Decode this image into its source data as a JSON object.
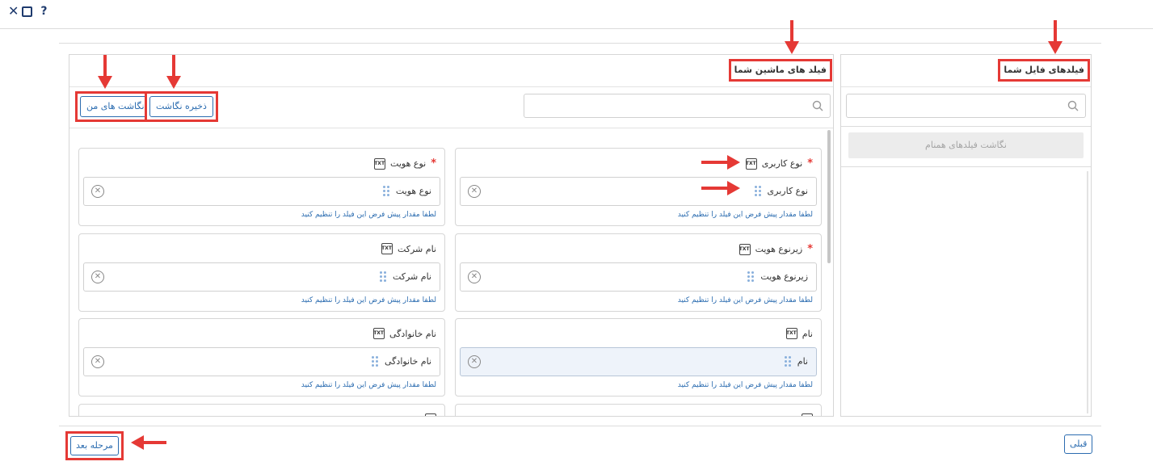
{
  "window": {
    "help_label": "?"
  },
  "file_panel": {
    "title": "فیلدهای فایل شما",
    "search_placeholder": "",
    "same_name_button": "نگاشت فیلدهای همنام"
  },
  "machine_panel": {
    "title": "فیلد های ماشین شما",
    "search_placeholder": "",
    "save_mapping_button": "ذخیره نگاشت",
    "my_mappings_button": "نگاشت های من"
  },
  "field_cards": [
    {
      "label": "نوع کاربری",
      "required": true,
      "value": "نوع کاربری",
      "hint": "لطفا مقدار پیش فرض این فیلد را تنظیم کنید",
      "active": false
    },
    {
      "label": "نوع هویت",
      "required": true,
      "value": "نوع هویت",
      "hint": "لطفا مقدار پیش فرض این فیلد را تنظیم کنید",
      "active": false
    },
    {
      "label": "زیرنوع هویت",
      "required": true,
      "value": "زیرنوع هویت",
      "hint": "لطفا مقدار پیش فرض این فیلد را تنظیم کنید",
      "active": false
    },
    {
      "label": "نام شرکت",
      "required": false,
      "value": "نام شرکت",
      "hint": "لطفا مقدار پیش فرض این فیلد را تنظیم کنید",
      "active": false
    },
    {
      "label": "نام",
      "required": false,
      "value": "نام",
      "hint": "لطفا مقدار پیش فرض این فیلد را تنظیم کنید",
      "active": true
    },
    {
      "label": "نام خانوادگی",
      "required": false,
      "value": "نام خانوادگی",
      "hint": "لطفا مقدار پیش فرض این فیلد را تنظیم کنید",
      "active": false
    }
  ],
  "field_type_icon": "TXT",
  "required_marker": "*",
  "footer": {
    "prev_button": "قبلی",
    "next_button": "مرحله بعد"
  },
  "icons": {
    "close": "close-icon",
    "maximize": "maximize-icon",
    "help": "help-icon",
    "search": "search-icon",
    "drag": "drag-handle-icon",
    "remove": "remove-circle-icon",
    "field_type": "txt-icon",
    "annotation": "red-arrow"
  },
  "colors": {
    "accent": "#2b6cb0",
    "annotation": "#e53935",
    "required": "#e53935",
    "disabled_bg": "#ececec",
    "border": "#d6d6d6"
  }
}
